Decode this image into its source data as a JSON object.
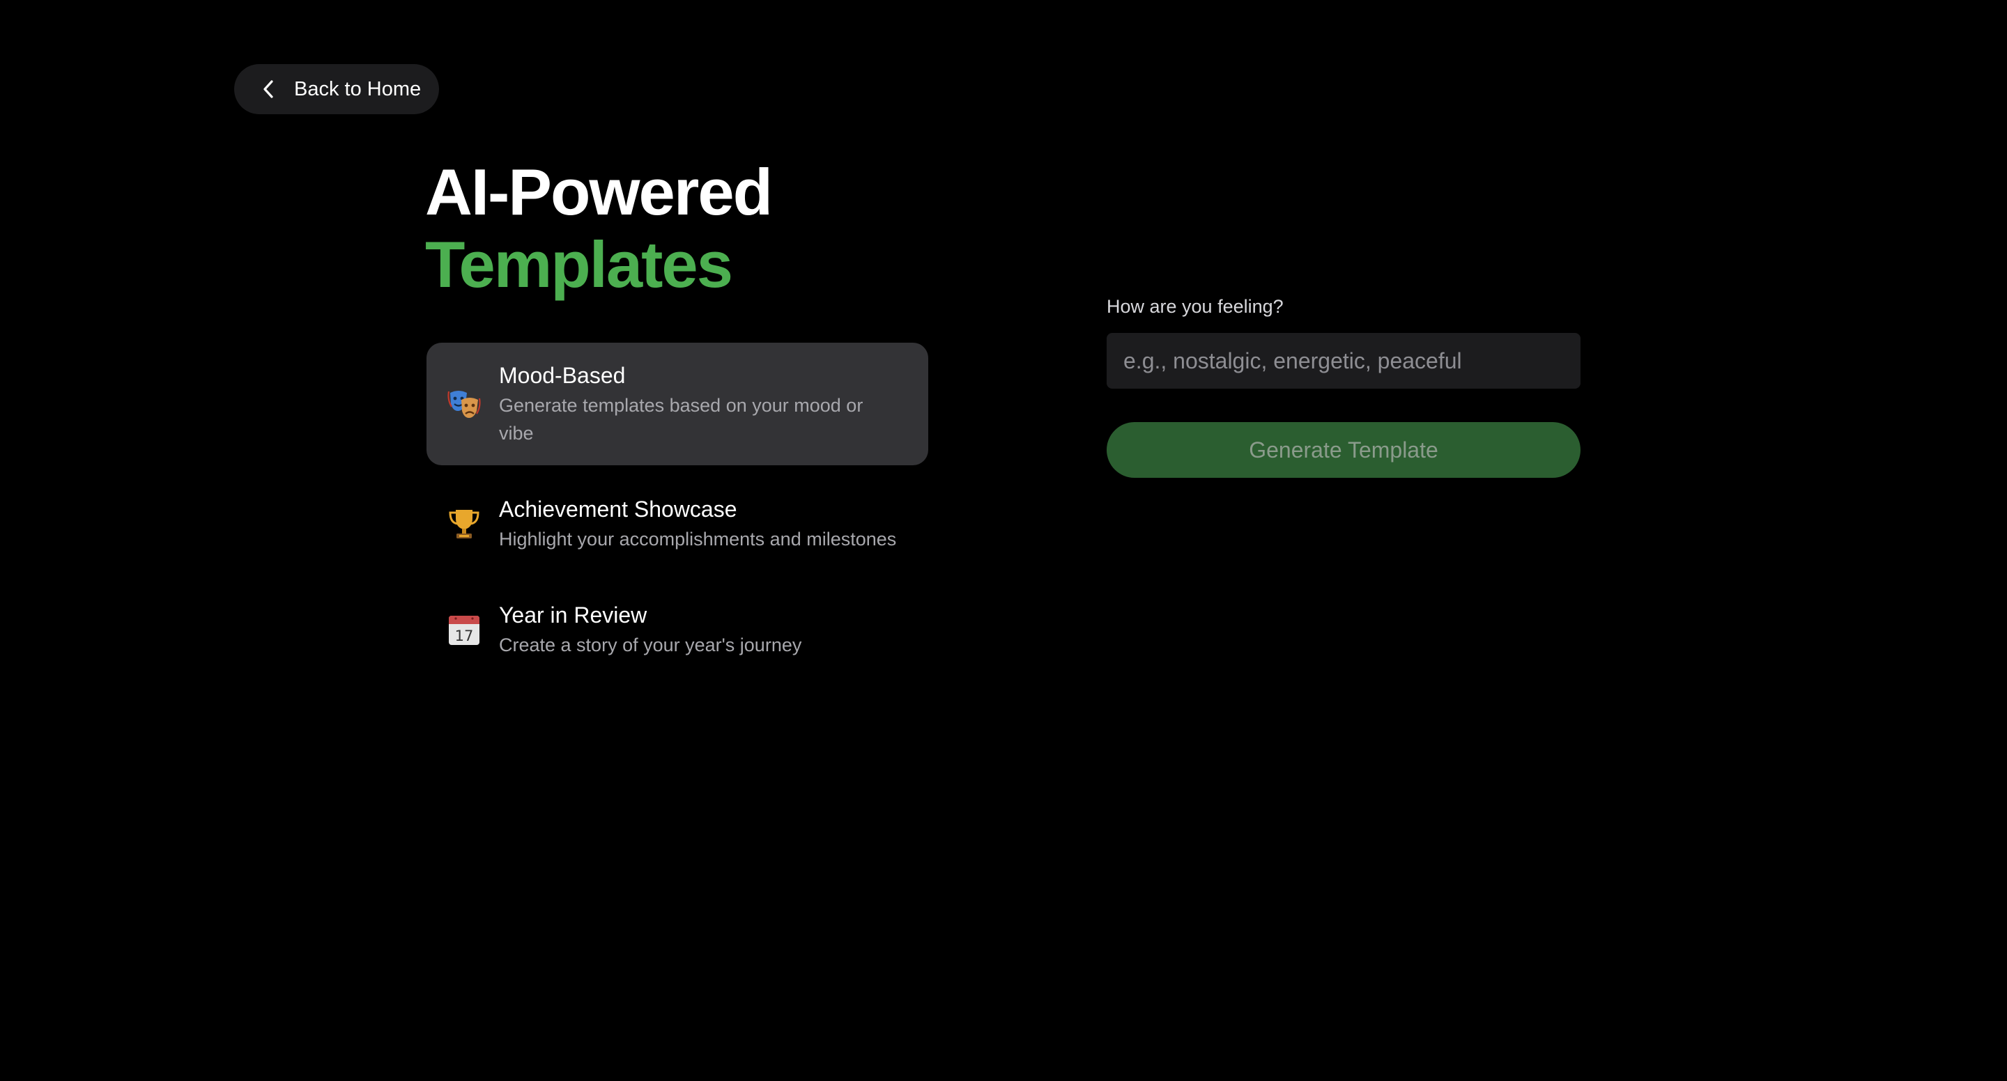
{
  "nav": {
    "back_label": "Back to Home"
  },
  "hero": {
    "title_line1": "AI-Powered",
    "title_line2": "Templates"
  },
  "templates": [
    {
      "icon": "theater-masks-icon",
      "title": "Mood-Based",
      "description": "Generate templates based on your mood or vibe",
      "selected": true
    },
    {
      "icon": "trophy-icon",
      "title": "Achievement Showcase",
      "description": "Highlight your accomplishments and milestones",
      "selected": false
    },
    {
      "icon": "calendar-icon",
      "title": "Year in Review",
      "description": "Create a story of your year's journey",
      "selected": false
    }
  ],
  "calendar_icon_day": "17",
  "form": {
    "label": "How are you feeling?",
    "value": "",
    "placeholder": "e.g., nostalgic, energetic, peaceful",
    "submit_label": "Generate Template"
  },
  "colors": {
    "background": "#000000",
    "accent": "#4caf50",
    "selected_card": "#333336",
    "button_disabled": "#2b5e30"
  }
}
